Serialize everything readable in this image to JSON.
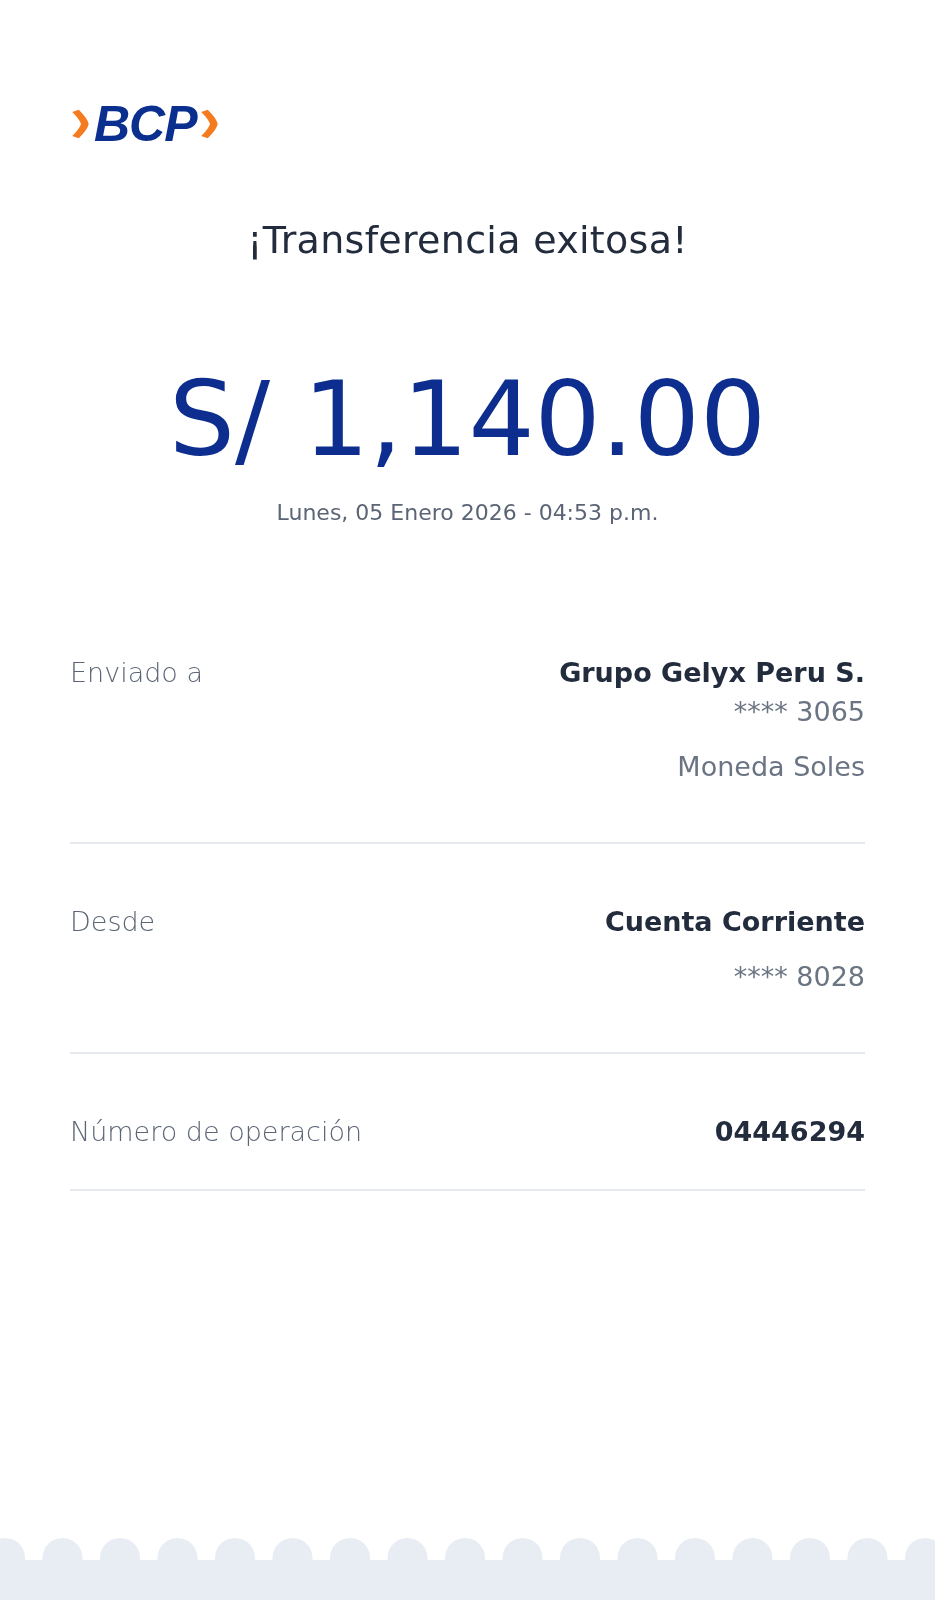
{
  "logo": {
    "text": "BCP"
  },
  "title": "¡Transferencia exitosa!",
  "amount": "S/ 1,140.00",
  "datetime": "Lunes, 05 Enero 2026 - 04:53 p.m.",
  "details": [
    {
      "label": "Enviado a",
      "values": [
        {
          "text": "Grupo Gelyx Peru S.",
          "kind": "strong"
        },
        {
          "text": "**** 3065",
          "kind": "plain"
        },
        {
          "text": "Moneda Soles",
          "kind": "spaced"
        }
      ]
    },
    {
      "label": "Desde",
      "values": [
        {
          "text": "Cuenta Corriente",
          "kind": "strong"
        },
        {
          "text": "**** 8028",
          "kind": "spaced"
        }
      ]
    },
    {
      "label": "Número de operación",
      "values": [
        {
          "text": "04446294",
          "kind": "strong"
        }
      ]
    }
  ]
}
